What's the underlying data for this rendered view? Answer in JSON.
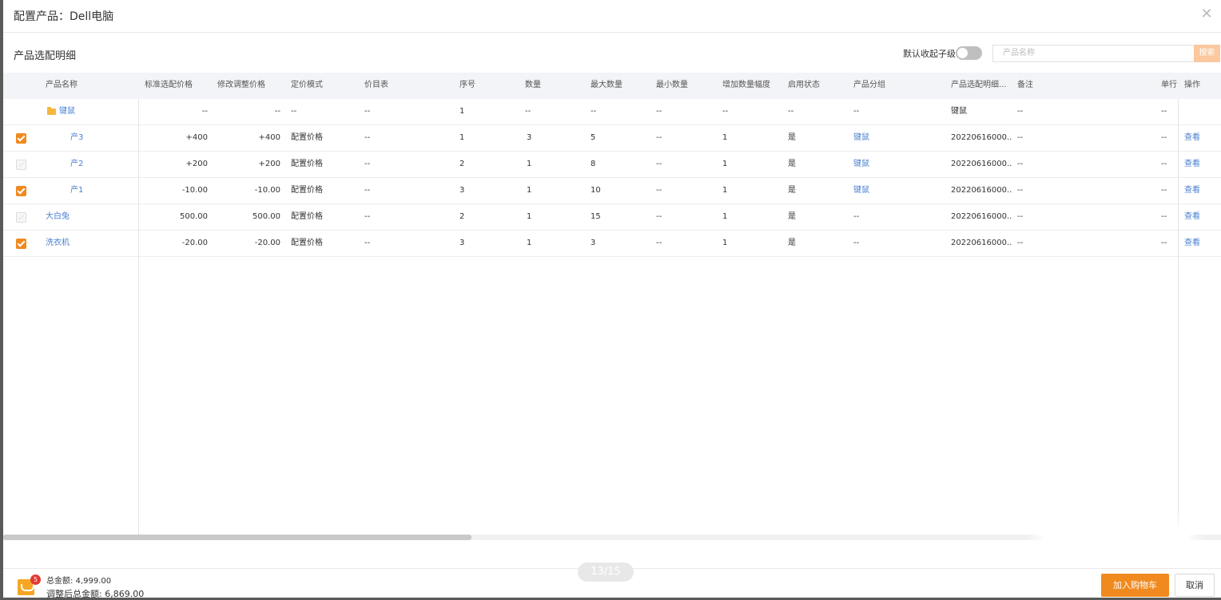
{
  "modal": {
    "title": "配置产品：Dell电脑",
    "close_icon": "close-icon"
  },
  "section": {
    "title": "产品选配明细",
    "toggle_label": "默认收起子级",
    "toggle_on": false
  },
  "search": {
    "placeholder": "产品名称",
    "button_label": "搜索"
  },
  "table": {
    "headers": {
      "name": "产品名称",
      "std_price": "标准选配价格",
      "adj_price": "修改调整价格",
      "pricing_mode": "定价模式",
      "price_list": "价目表",
      "seq": "序号",
      "qty": "数量",
      "max_qty": "最大数量",
      "min_qty": "最小数量",
      "incr": "增加数量幅度",
      "enabled": "启用状态",
      "group": "产品分组",
      "detail": "产品选配明细...",
      "remark": "备注",
      "unit": "单行",
      "action": "操作"
    },
    "rows": [
      {
        "checkbox": "none",
        "name": "键鼠",
        "is_group": true,
        "std_price": "--",
        "adj_price": "--",
        "pricing_mode": "--",
        "price_list": "--",
        "seq": "1",
        "qty": "--",
        "max_qty": "--",
        "min_qty": "--",
        "incr": "--",
        "enabled": "--",
        "group": "--",
        "detail": "键鼠",
        "remark": "--",
        "unit": "--",
        "action": ""
      },
      {
        "checkbox": "checked",
        "name": "产3",
        "std_price": "+400",
        "adj_price": "+400",
        "pricing_mode": "配置价格",
        "price_list": "--",
        "seq": "1",
        "qty": "3",
        "max_qty": "5",
        "min_qty": "--",
        "incr": "1",
        "enabled": "是",
        "group": "键鼠",
        "detail": "20220616000...",
        "remark": "--",
        "unit": "--",
        "action": "查看"
      },
      {
        "checkbox": "disabled",
        "name": "产2",
        "std_price": "+200",
        "adj_price": "+200",
        "pricing_mode": "配置价格",
        "price_list": "--",
        "seq": "2",
        "qty": "1",
        "max_qty": "8",
        "min_qty": "--",
        "incr": "1",
        "enabled": "是",
        "group": "键鼠",
        "detail": "20220616000...",
        "remark": "--",
        "unit": "--",
        "action": "查看"
      },
      {
        "checkbox": "checked",
        "name": "产1",
        "std_price": "-10.00",
        "adj_price": "-10.00",
        "pricing_mode": "配置价格",
        "price_list": "--",
        "seq": "3",
        "qty": "1",
        "max_qty": "10",
        "min_qty": "--",
        "incr": "1",
        "enabled": "是",
        "group": "键鼠",
        "detail": "20220616000...",
        "remark": "--",
        "unit": "--",
        "action": "查看"
      },
      {
        "checkbox": "disabled",
        "name": "大白兔",
        "std_price": "500.00",
        "adj_price": "500.00",
        "pricing_mode": "配置价格",
        "price_list": "--",
        "seq": "2",
        "qty": "1",
        "max_qty": "15",
        "min_qty": "--",
        "incr": "1",
        "enabled": "是",
        "group": "--",
        "detail": "20220616000...",
        "remark": "--",
        "unit": "--",
        "action": "查看"
      },
      {
        "checkbox": "checked",
        "name": "洗衣机",
        "std_price": "-20.00",
        "adj_price": "-20.00",
        "pricing_mode": "配置价格",
        "price_list": "--",
        "seq": "3",
        "qty": "1",
        "max_qty": "3",
        "min_qty": "--",
        "incr": "1",
        "enabled": "是",
        "group": "--",
        "detail": "20220616000...",
        "remark": "--",
        "unit": "--",
        "action": "查看"
      }
    ]
  },
  "footer": {
    "cart_badge": "5",
    "total_label": "总金额: 4,999.00",
    "adjusted_total_label": "调整后总金额: 6,869.00",
    "page_indicator": "13/15",
    "add_to_cart": "加入购物车",
    "cancel": "取消"
  },
  "colors": {
    "accent": "#f08a1f",
    "link": "#4a7fd0"
  }
}
